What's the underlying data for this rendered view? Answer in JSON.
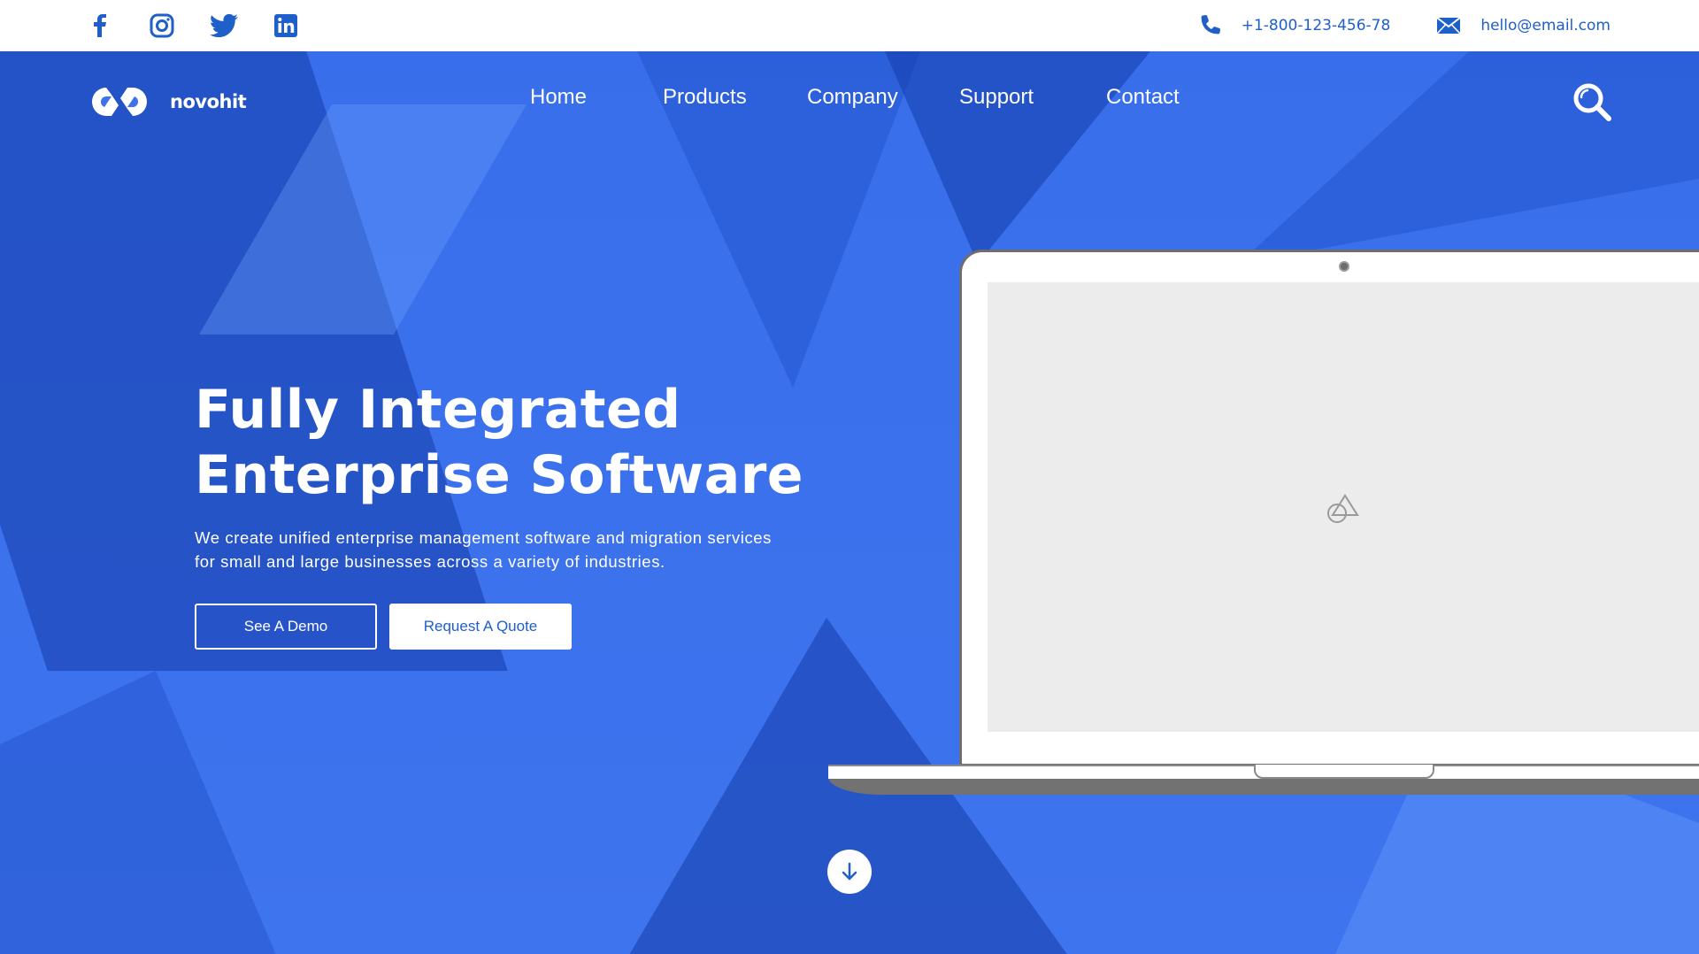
{
  "topbar": {
    "social": [
      {
        "icon": "facebook-icon"
      },
      {
        "icon": "instagram-icon"
      },
      {
        "icon": "twitter-icon"
      },
      {
        "icon": "linkedin-icon"
      }
    ],
    "phone": {
      "icon": "phone-icon",
      "text": "+1-800-123-456-78"
    },
    "email": {
      "icon": "mail-icon",
      "text": "hello@email.com"
    }
  },
  "brand": {
    "name": "novohit"
  },
  "nav": {
    "items": [
      {
        "label": "Home"
      },
      {
        "label": "Products"
      },
      {
        "label": "Company"
      },
      {
        "label": "Support"
      },
      {
        "label": "Contact"
      }
    ],
    "search_icon": "search-icon"
  },
  "hero": {
    "title_line1": "Fully Integrated",
    "title_line2": "Enterprise Software",
    "subtitle_line1": "We create unified enterprise management software and migration services",
    "subtitle_line2": "for small and large businesses across a variety of industries.",
    "primary_button": "See A Demo",
    "secondary_button": "Request A Quote"
  },
  "laptop": {
    "screen_icon": "image-placeholder-icon"
  },
  "scroll_icon": "arrow-down-icon",
  "colors": {
    "accent": "#1f5fc9",
    "hero_bg": "#3d72ea",
    "white": "#ffffff",
    "screen": "#ececec"
  }
}
